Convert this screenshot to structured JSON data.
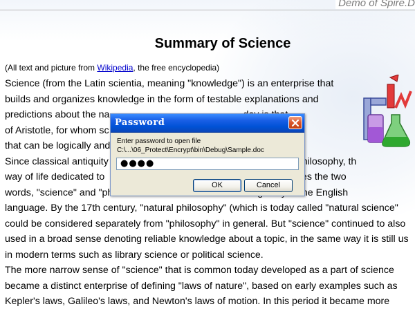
{
  "header": {
    "text": "Demo of Spire.D"
  },
  "document": {
    "title": "Summary of Science",
    "attribution_prefix": "(All text and picture from ",
    "attribution_link": "Wikipedia",
    "attribution_suffix": ", the free encyclopedia)",
    "lines": [
      "Science (from the Latin scientia, meaning \"knowledge\") is an enterprise that",
      "builds and organizes knowledge in the form of testable explanations and",
      "predictions about the na                                                 day is that",
      "of Aristotle, for whom sc                                                 nowledge",
      "that can be logically and",
      "Since classical antiquity                                                   ly linked to philosophy, th",
      "way of life dedicated to                                                    r modern times the two",
      "words, \"science\" and \"ph                                                   ngeably in the English",
      "language. By the 17th century, \"natural philosophy\" (which is today called \"natural science\"",
      "could be considered separately from \"philosophy\" in general. But \"science\" continued to also",
      "used in a broad sense denoting reliable knowledge about a topic, in the same way it is still us",
      "in modern terms such as library science or political science.",
      "The more narrow sense of \"science\" that is common today developed as a part of science",
      "became a distinct enterprise of defining \"laws of nature\", based on early examples such as",
      "Kepler's laws, Galileo's laws, and Newton's laws of motion. In this period it became more"
    ]
  },
  "dialog": {
    "title": "Password",
    "prompt": "Enter password to open file",
    "file_path": "C:\\...\\06_Protect\\Encrypt\\bin\\Debug\\Sample.doc",
    "password_value": "●●●●",
    "ok_label": "OK",
    "cancel_label": "Cancel"
  },
  "colors": {
    "titlebar": "#0052d6",
    "close_button": "#d8532a",
    "dialog_background": "#ece9d8",
    "link": "#0000cc"
  },
  "icons": {
    "close": "close-icon",
    "logo": "science-flask-logo"
  }
}
